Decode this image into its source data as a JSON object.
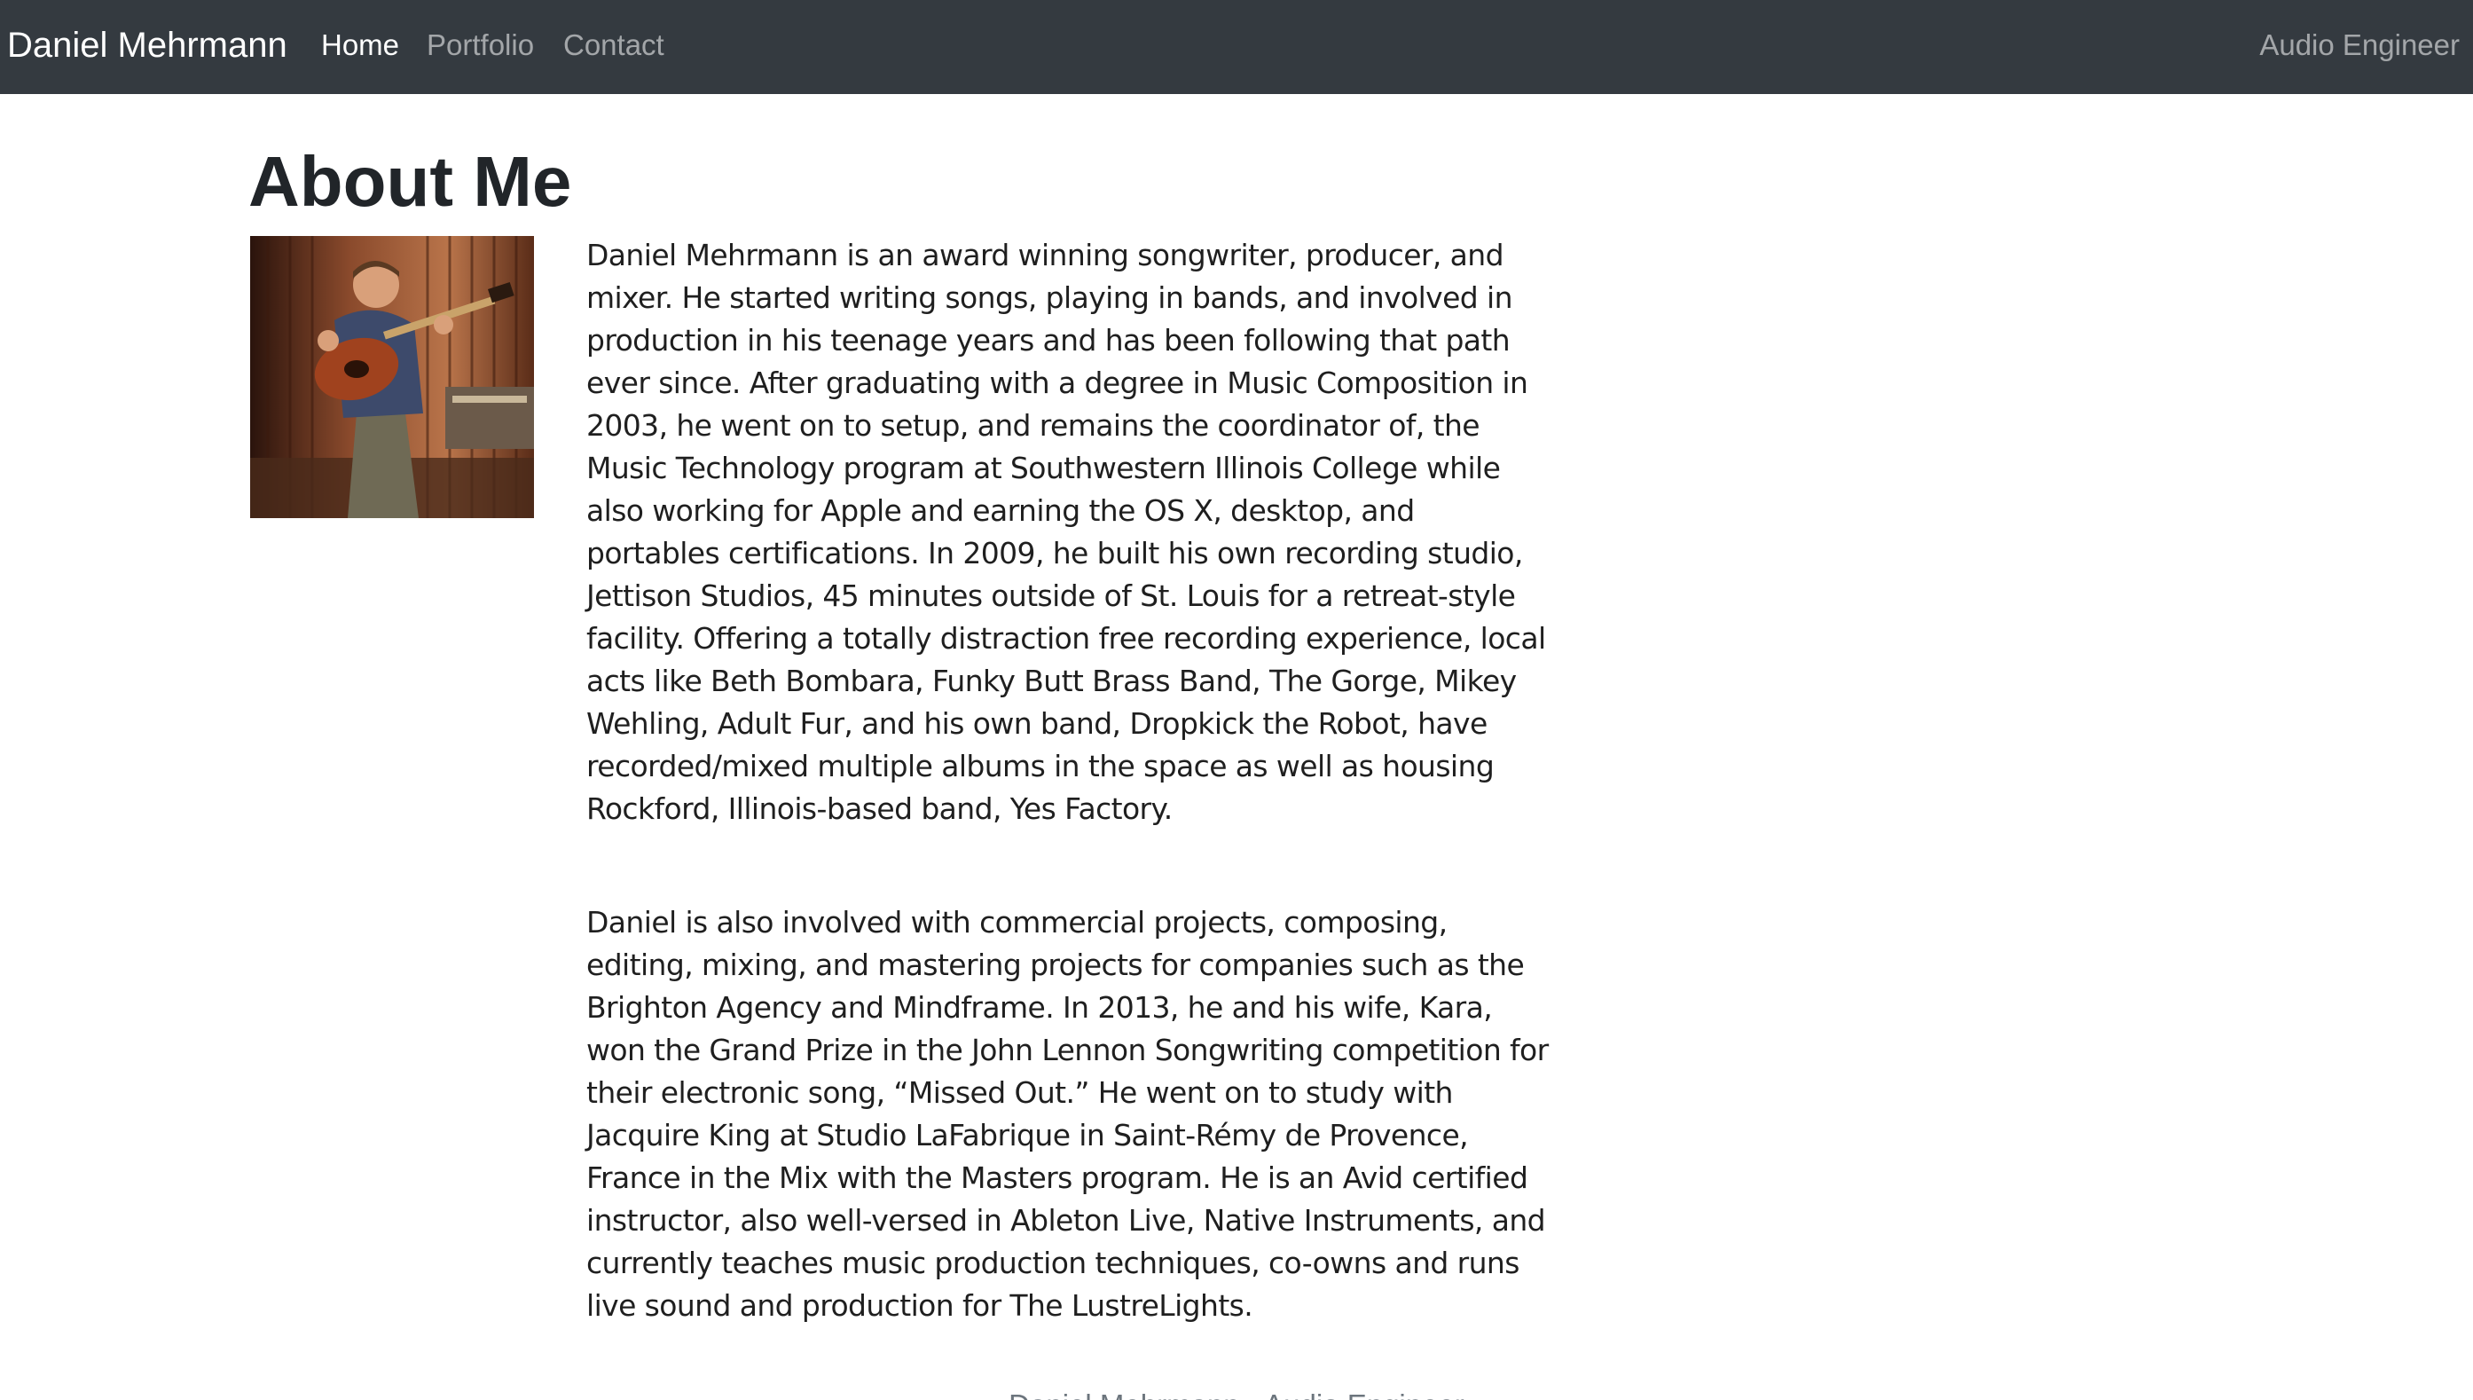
{
  "navbar": {
    "brand": "Daniel Mehrmann",
    "links": [
      {
        "label": "Home",
        "active": true
      },
      {
        "label": "Portfolio",
        "active": false
      },
      {
        "label": "Contact",
        "active": false
      }
    ],
    "right_text": "Audio Engineer"
  },
  "main": {
    "title": "About Me",
    "paragraphs": [
      "Daniel Mehrmann is an award winning songwriter, producer, and mixer. He started writing songs, playing in bands, and involved in production in his teenage years and has been following that path ever since. After graduating with a degree in Music Composition in 2003, he went on to setup, and remains the coordinator of, the Music Technology program at Southwestern Illinois College while also working for Apple and earning the OS X, desktop, and portables certifications. In 2009, he built his own recording studio, Jettison Studios, 45 minutes outside of St. Louis for a retreat-style facility. Offering a totally distraction free recording experience, local acts like Beth Bombara, Funky Butt Brass Band, The Gorge, Mikey Wehling, Adult Fur, and his own band, Dropkick the Robot, have recorded/mixed multiple albums in the space as well as housing Rockford, Illinois-based band, Yes Factory.",
      "Daniel is also involved with commercial projects, composing, editing, mixing, and mastering projects for companies such as the Brighton Agency and Mindframe. In 2013, he and his wife, Kara, won the Grand Prize in the John Lennon Songwriting competition for their electronic song, “Missed Out.” He went on to study with Jacquire King at Studio LaFabrique in Saint-Rémy de Provence, France in the Mix with the Masters program. He is an Avid certified instructor, also well-versed in Ableton Live, Native Instruments, and currently teaches music production techniques, co-owns and runs live sound and production for The LustreLights."
    ]
  },
  "footer": {
    "text": "Daniel Mehrmann - Audio Engineer"
  },
  "colors": {
    "navbar_bg": "#343a40",
    "nav_active": "#ffffff",
    "nav_inactive": "rgba(255,255,255,0.55)",
    "text": "#212529"
  }
}
